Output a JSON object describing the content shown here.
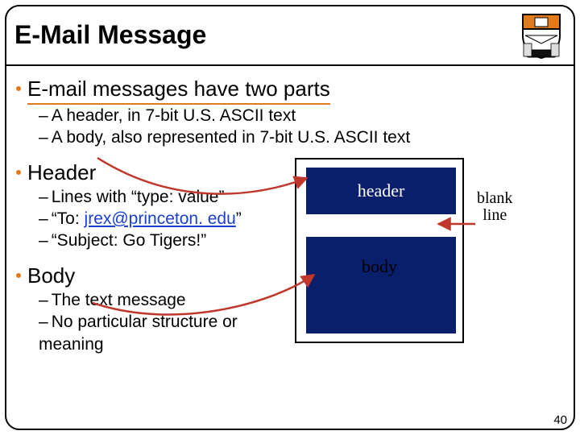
{
  "title": "E-Mail Message",
  "bullets": {
    "b1": {
      "text": "E-mail messages have two parts",
      "subs": [
        "A header, in 7-bit U.S. ASCII text",
        "A body, also represented in 7-bit U.S. ASCII text"
      ]
    },
    "b2": {
      "text": "Header",
      "subs_pre": "Lines with “type: value”",
      "subs_to_prefix": "“To: ",
      "subs_to_link": "jrex@princeton. edu",
      "subs_to_suffix": "”",
      "subs_subject": "“Subject: Go Tigers!”"
    },
    "b3": {
      "text": "Body",
      "subs": [
        "The text message",
        "No particular structure or meaning"
      ]
    }
  },
  "diagram": {
    "header_label": "header",
    "body_label": "body",
    "annotation": "blank\nline"
  },
  "page_number": "40"
}
